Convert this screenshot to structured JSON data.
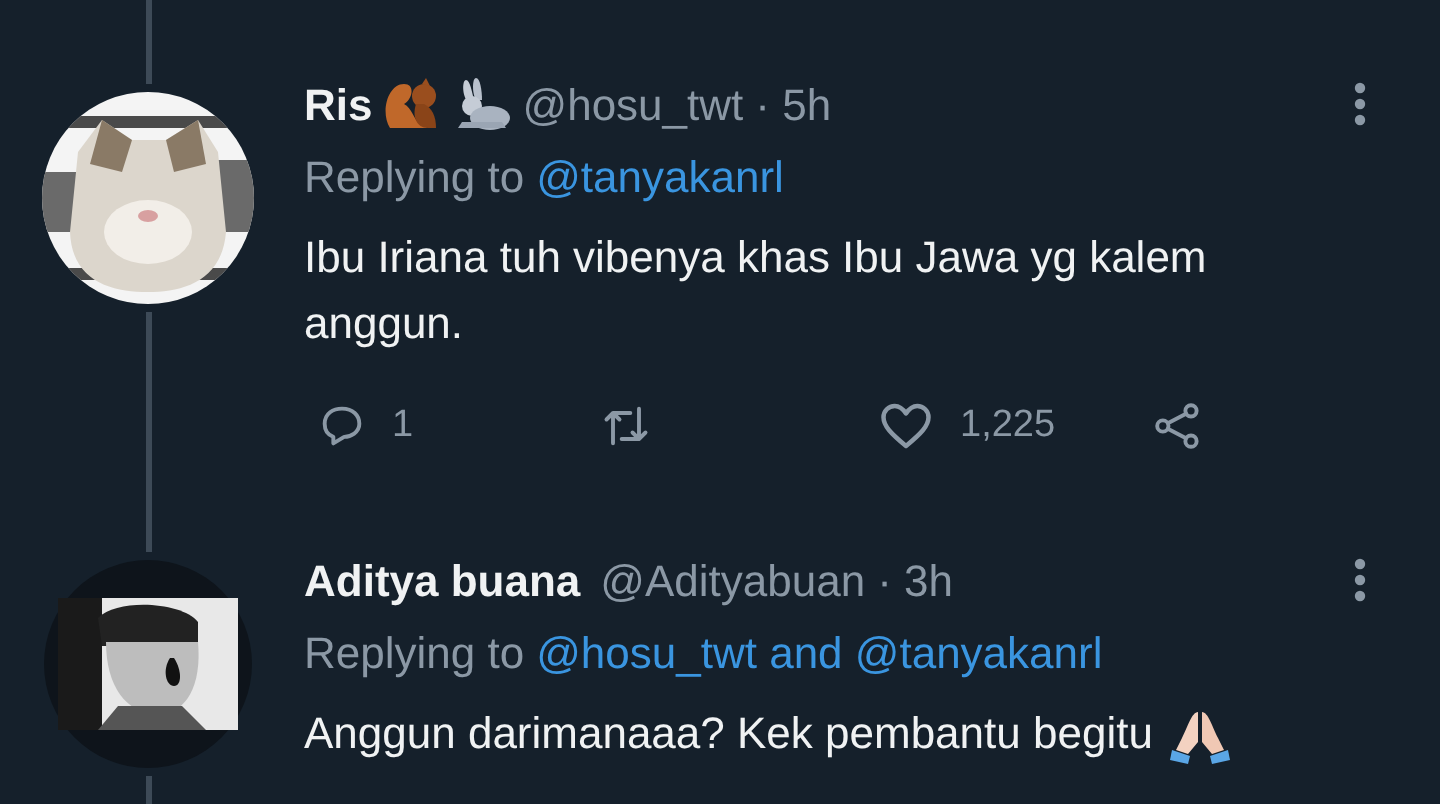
{
  "tweets": [
    {
      "name": "Ris",
      "name_emojis": [
        {
          "kind": "squirrel"
        },
        {
          "kind": "rabbit"
        }
      ],
      "handle": "@hosu_twt",
      "time": "· 5h",
      "replying_label": "Replying to",
      "reply_to": "@tanyakanrl",
      "body": "Ibu Iriana tuh vibenya khas Ibu Jawa yg kalem anggun.",
      "avatar": {
        "kind": "picture"
      },
      "actions": {
        "replies": "1",
        "likes": "1,225"
      }
    },
    {
      "name": "Aditya buana",
      "handle": "@Adityabuan",
      "time": "· 3h",
      "replying_label": "Replying to",
      "reply_to": "@hosu_twt and @tanyakanrl",
      "body": "Anggun darimanaaa? Kek pembantu begitu",
      "body_emojis": [
        {
          "kind": "folded-hands"
        }
      ],
      "avatar": {
        "kind": "picture"
      }
    }
  ]
}
